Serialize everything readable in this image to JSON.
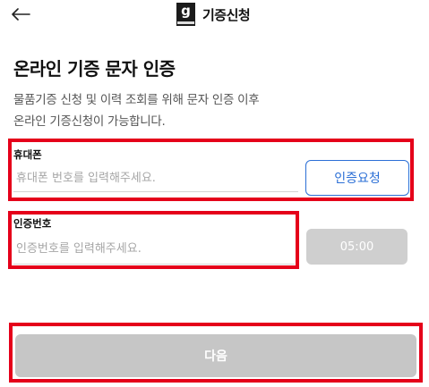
{
  "header": {
    "back_icon": "arrow-left-icon",
    "logo_icon": "goodwill-logo-icon",
    "title": "기증신청"
  },
  "page": {
    "title": "온라인 기증 문자 인증",
    "description_line1": "물품기증 신청 및 이력 조회를 위해 문자 인증 이후",
    "description_line2": "온라인 기증신청이 가능합니다."
  },
  "phone": {
    "label": "휴대폰",
    "value": "",
    "placeholder": "휴대폰 번호를 입력해주세요.",
    "request_button": "인증요청"
  },
  "auth_code": {
    "label": "인증번호",
    "value": "",
    "placeholder": "인증번호를 입력해주세요.",
    "timer": "05:00"
  },
  "next_button": "다음",
  "colors": {
    "accent": "#2b6fd6",
    "highlight": "#e5001a",
    "disabled": "#c6c6c6"
  }
}
